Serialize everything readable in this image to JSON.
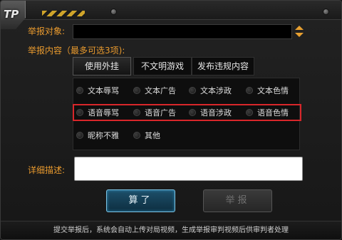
{
  "logo": {
    "text": "TP"
  },
  "report_target": {
    "label": "举报对象:",
    "value": ""
  },
  "report_content": {
    "label": "举报内容（最多可选3项):"
  },
  "tabs": [
    {
      "label": "使用外挂",
      "active": true
    },
    {
      "label": "不文明游戏",
      "active": false
    },
    {
      "label": "发布违规内容",
      "active": false
    }
  ],
  "options": {
    "row1": [
      "文本辱骂",
      "文本广告",
      "文本涉政",
      "文本色情"
    ],
    "row2": [
      "语音辱骂",
      "语音广告",
      "语音涉政",
      "语音色情"
    ],
    "row3": [
      "昵称不雅",
      "其他"
    ]
  },
  "detail": {
    "label": "详细描述:",
    "value": ""
  },
  "buttons": {
    "calc": "算了",
    "report": "举报"
  },
  "footer": {
    "text": "提交举报后，系统会自动上传对局视频，生成举报审判视频后供审判者处理"
  },
  "colors": {
    "label": "#e99a2e",
    "highlight": "#d8262a",
    "calc_border": "#7ec2e2"
  }
}
